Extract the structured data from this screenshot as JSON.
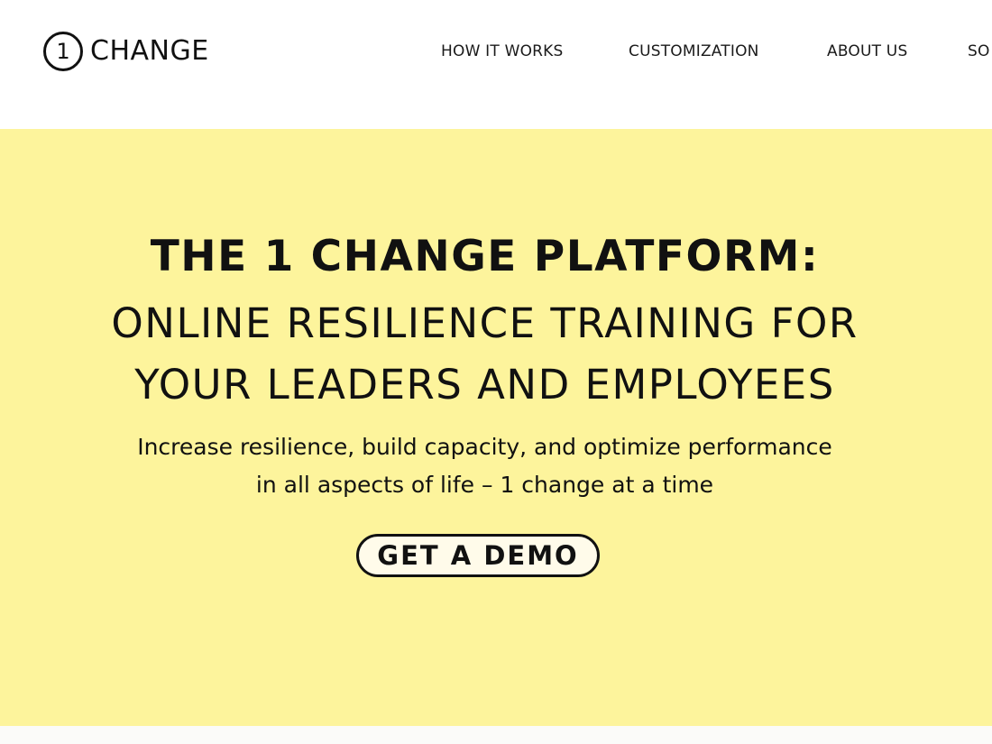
{
  "header": {
    "logo": {
      "numeral": "1",
      "wordmark": "CHANGE"
    },
    "nav": [
      {
        "label": "HOW IT WORKS"
      },
      {
        "label": "CUSTOMIZATION"
      },
      {
        "label": "ABOUT US"
      },
      {
        "label": "SO"
      }
    ]
  },
  "hero": {
    "title": "THE 1 CHANGE PLATFORM:",
    "subtitle_lines": [
      "ONLINE RESILIENCE TRAINING FOR",
      "YOUR LEADERS AND EMPLOYEES"
    ],
    "description_lines": [
      "Increase resilience, build capacity, and optimize performance",
      "in all aspects of life – 1 change at a time"
    ],
    "cta_label": "GET A DEMO"
  },
  "colors": {
    "hero_background": "#fdf49c",
    "text": "#111111",
    "header_background": "#ffffff"
  }
}
